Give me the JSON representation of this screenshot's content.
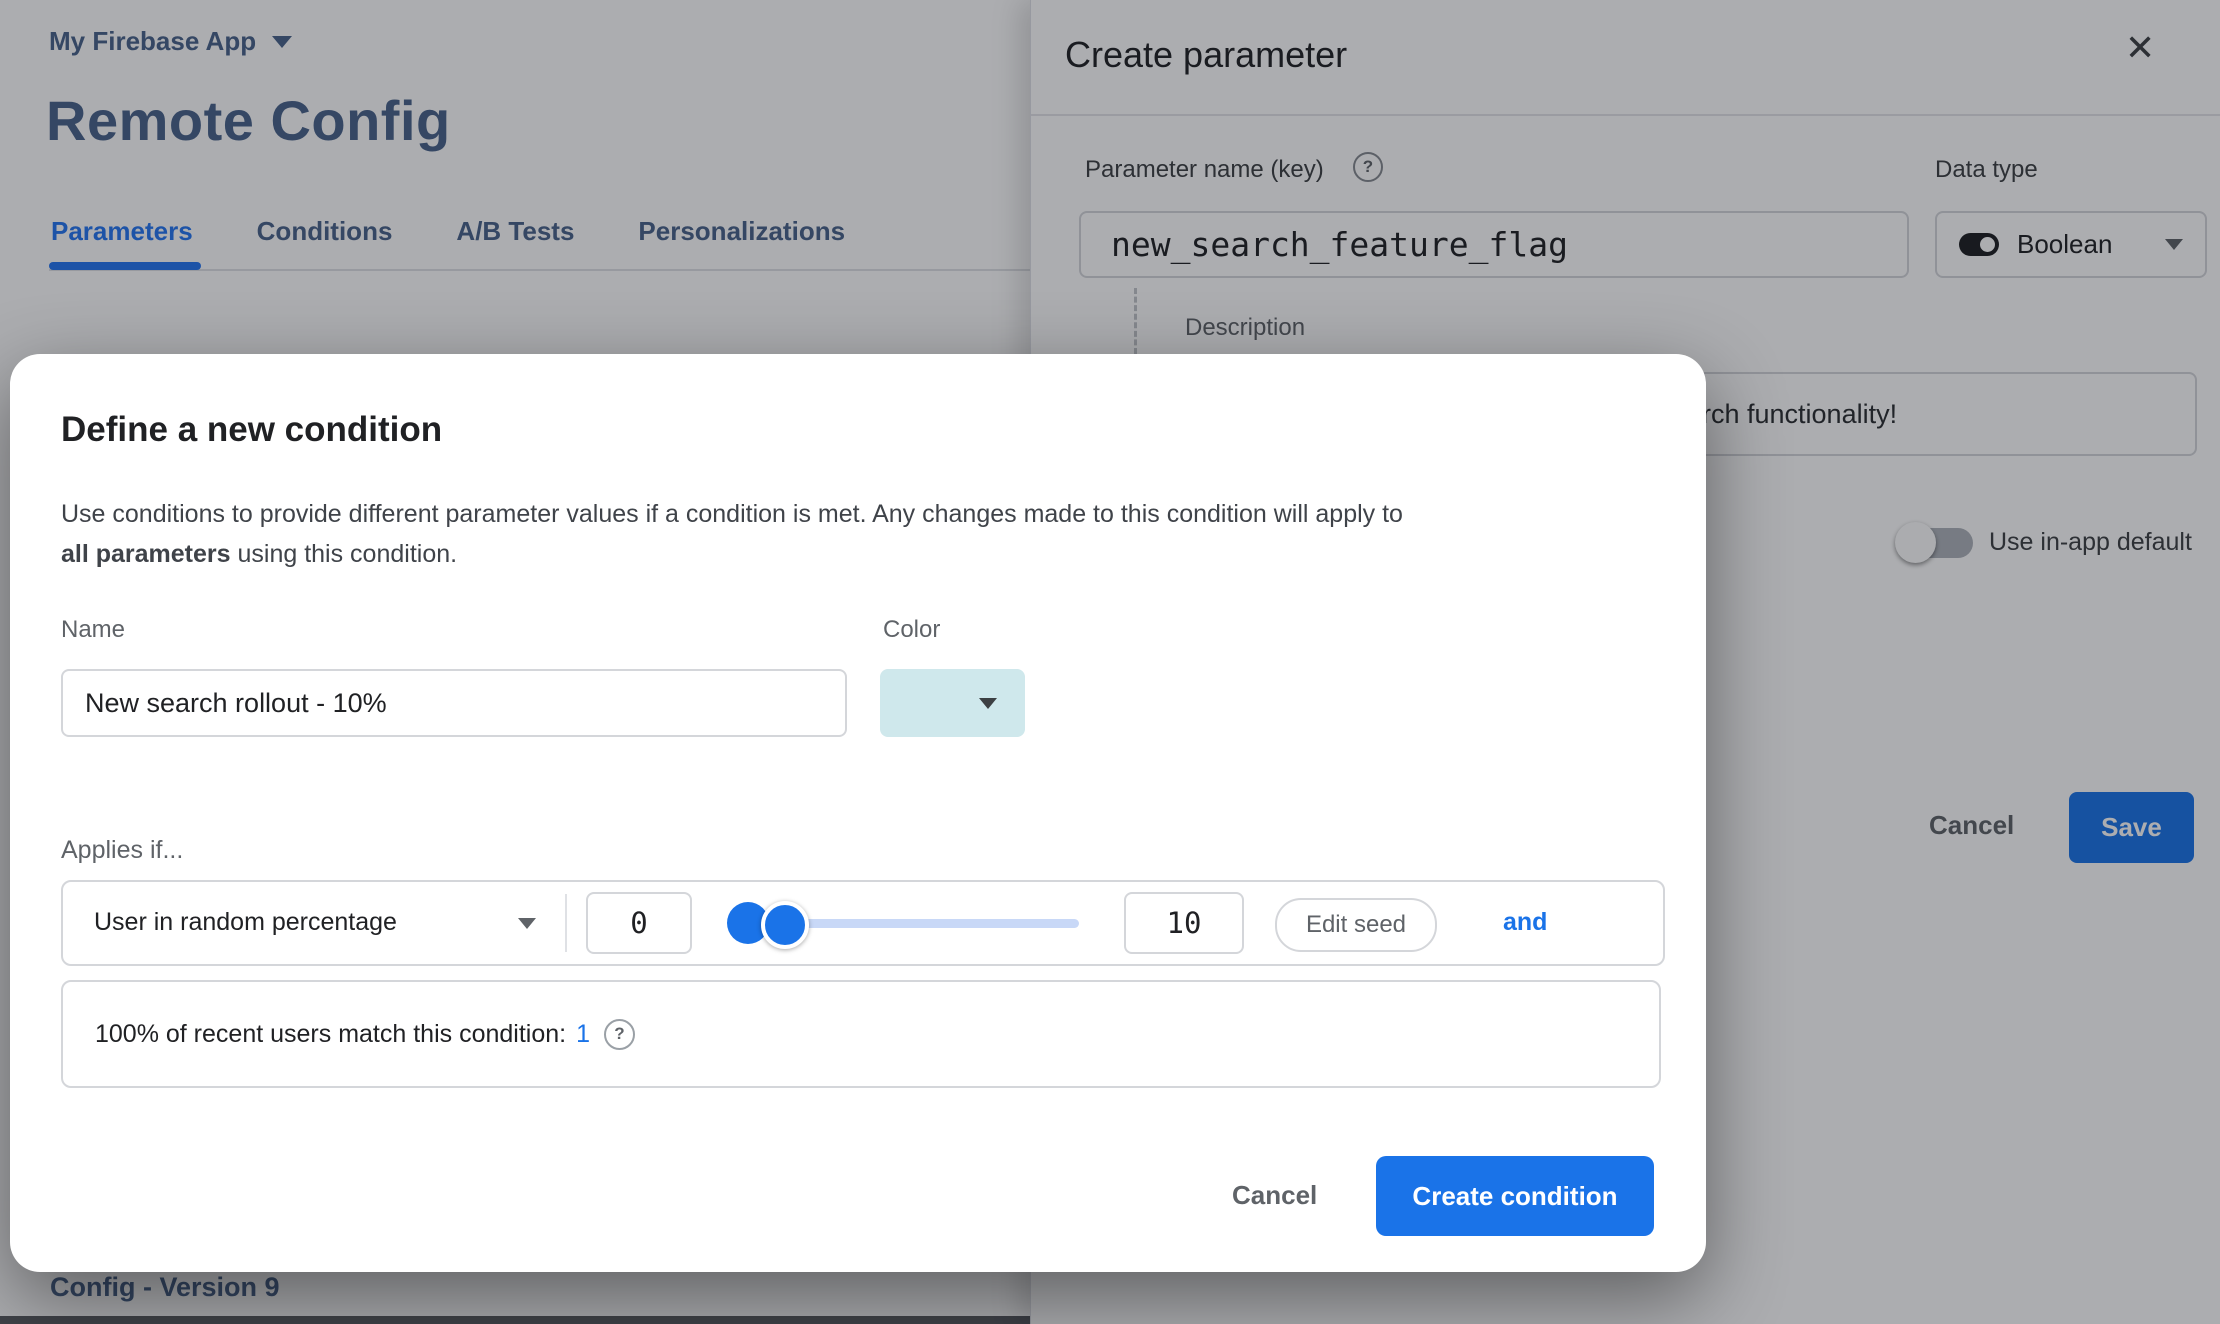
{
  "colors": {
    "accent_blue": "#1a73e8",
    "active_tab_blue": "#2476f2",
    "brand_navy": "#49638a",
    "condition_color_swatch": "#cfe8ec",
    "slider_track": "#c8d8f7",
    "border_gray": "#dadce0",
    "scrim": "rgba(16,20,30,0.35)"
  },
  "background": {
    "project_name": "My Firebase App",
    "page_title": "Remote Config",
    "tabs": [
      {
        "label": "Parameters",
        "active": true
      },
      {
        "label": "Conditions",
        "active": false
      },
      {
        "label": "A/B Tests",
        "active": false
      },
      {
        "label": "Personalizations",
        "active": false
      }
    ],
    "footer_heading": "Config - Version 9"
  },
  "panel": {
    "title": "Create parameter",
    "close_icon": "✕",
    "param_name_label": "Parameter name (key)",
    "param_name_help_icon": "?",
    "param_name_value": "new_search_feature_flag",
    "data_type_label": "Data type",
    "data_type_value": "Boolean",
    "description_label": "Description",
    "description_visible_text": "rch functionality!",
    "default_toggle_label": "Use in-app default",
    "cancel_label": "Cancel",
    "save_label": "Save"
  },
  "modal": {
    "title": "Define a new condition",
    "description_line1": "Use conditions to provide different parameter values if a condition is met. Any changes made to this condition will apply to",
    "description_line2_bold": "all parameters",
    "description_line2_rest": " using this condition.",
    "name_label": "Name",
    "name_value": "New search rollout - 10%",
    "color_label": "Color",
    "applies_label": "Applies if...",
    "condition": {
      "selector_value": "User in random percentage",
      "min_value": "0",
      "max_value": "10",
      "slider_range_pct": "0-10",
      "edit_seed_label": "Edit seed",
      "and_label": "and"
    },
    "match_info": {
      "prefix": "100% of recent users match this condition:",
      "value": "1",
      "help_icon": "?"
    },
    "cancel_label": "Cancel",
    "create_label": "Create condition"
  }
}
